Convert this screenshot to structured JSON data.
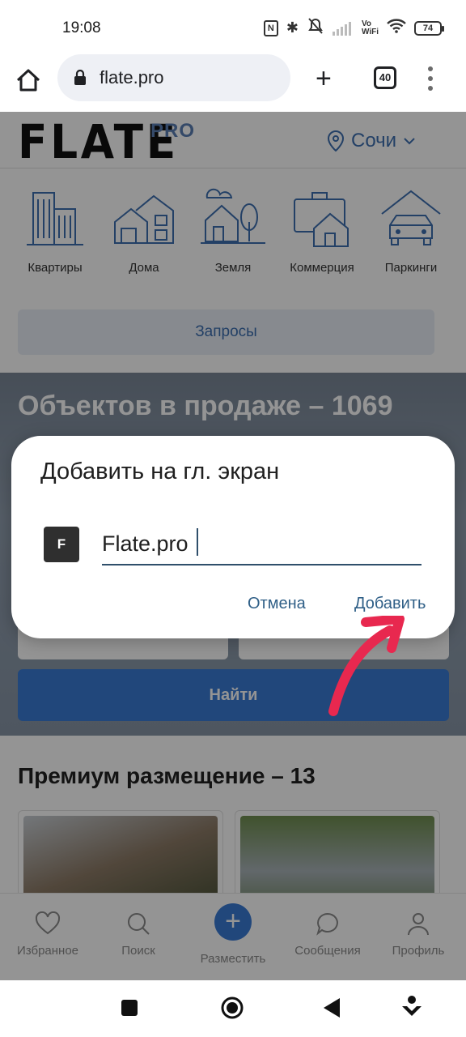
{
  "status_bar": {
    "time": "19:08",
    "vowifi_top": "Vo",
    "vowifi_bottom": "WiFi",
    "battery": "74"
  },
  "browser": {
    "url": "flate.pro",
    "tab_count": "40"
  },
  "site": {
    "logo": "FLATE",
    "logo_suffix": "PRO",
    "city": "Сочи",
    "categories": [
      {
        "label": "Квартиры",
        "icon": "apartments-icon"
      },
      {
        "label": "Дома",
        "icon": "houses-icon"
      },
      {
        "label": "Земля",
        "icon": "land-icon"
      },
      {
        "label": "Коммерция",
        "icon": "commerce-icon"
      },
      {
        "label": "Паркинги",
        "icon": "parking-icon"
      }
    ],
    "requests_label": "Запросы",
    "hero_title": "Объектов в продаже – 1069",
    "find_label": "Найти",
    "premium_title": "Премиум размещение – 13"
  },
  "bottom_nav": [
    {
      "label": "Избранное",
      "icon": "heart-icon"
    },
    {
      "label": "Поиск",
      "icon": "search-icon"
    },
    {
      "label": "Разместить",
      "icon": "plus-icon"
    },
    {
      "label": "Сообщения",
      "icon": "chat-icon"
    },
    {
      "label": "Профиль",
      "icon": "profile-icon"
    }
  ],
  "dialog": {
    "title": "Добавить на гл. экран",
    "favicon_letter": "F",
    "name_value": "Flate.pro",
    "cancel_label": "Отмена",
    "add_label": "Добавить"
  },
  "colors": {
    "brand_blue": "#3a7bd5",
    "link_blue": "#3d6fb0",
    "dialog_button": "#2f5f87",
    "annotation_arrow": "#e8284f"
  }
}
